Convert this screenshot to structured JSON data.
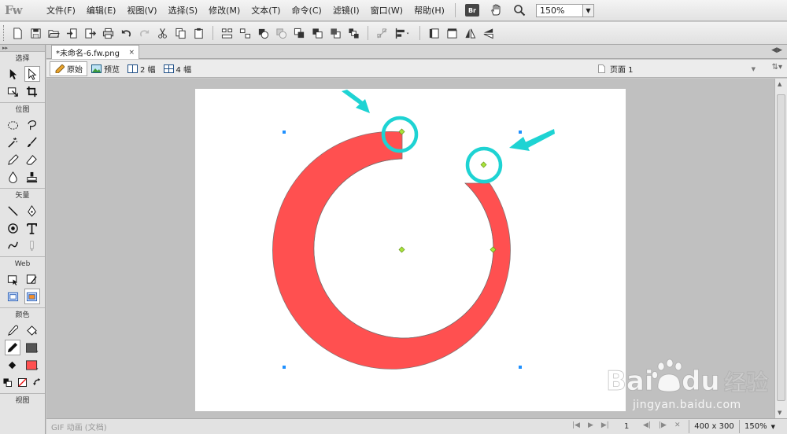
{
  "app": {
    "logo": "Fw"
  },
  "menu": [
    "文件(F)",
    "编辑(E)",
    "视图(V)",
    "选择(S)",
    "修改(M)",
    "文本(T)",
    "命令(C)",
    "滤镜(I)",
    "窗口(W)",
    "帮助(H)"
  ],
  "menubar_extra": {
    "bridge_badge": "Br",
    "zoom_value": "150%"
  },
  "tools_panel": {
    "sections": [
      "选择",
      "位图",
      "矢量",
      "Web",
      "颜色",
      "视图"
    ],
    "stroke_color": "#555555",
    "fill_color": "#ff5050"
  },
  "document": {
    "tab_title": "*未命名-6.fw.png",
    "tab_close": "×",
    "views": [
      "原始",
      "预览",
      "2 幅",
      "4 幅"
    ],
    "page_label": "页面 1"
  },
  "canvas": {
    "background": "#ffffff",
    "ring_color": "#ff5050",
    "highlight_color": "#1ed3d3",
    "point_color": "#a8e23a",
    "selection_handle_color": "#1e90ff"
  },
  "status": {
    "text": "GIF 动画 (文档)",
    "frame": "1",
    "size": "400 x 300",
    "zoom": "150%"
  },
  "watermark": {
    "brand": "Baidu",
    "cn": "经验",
    "url": "jingyan.baidu.com"
  }
}
